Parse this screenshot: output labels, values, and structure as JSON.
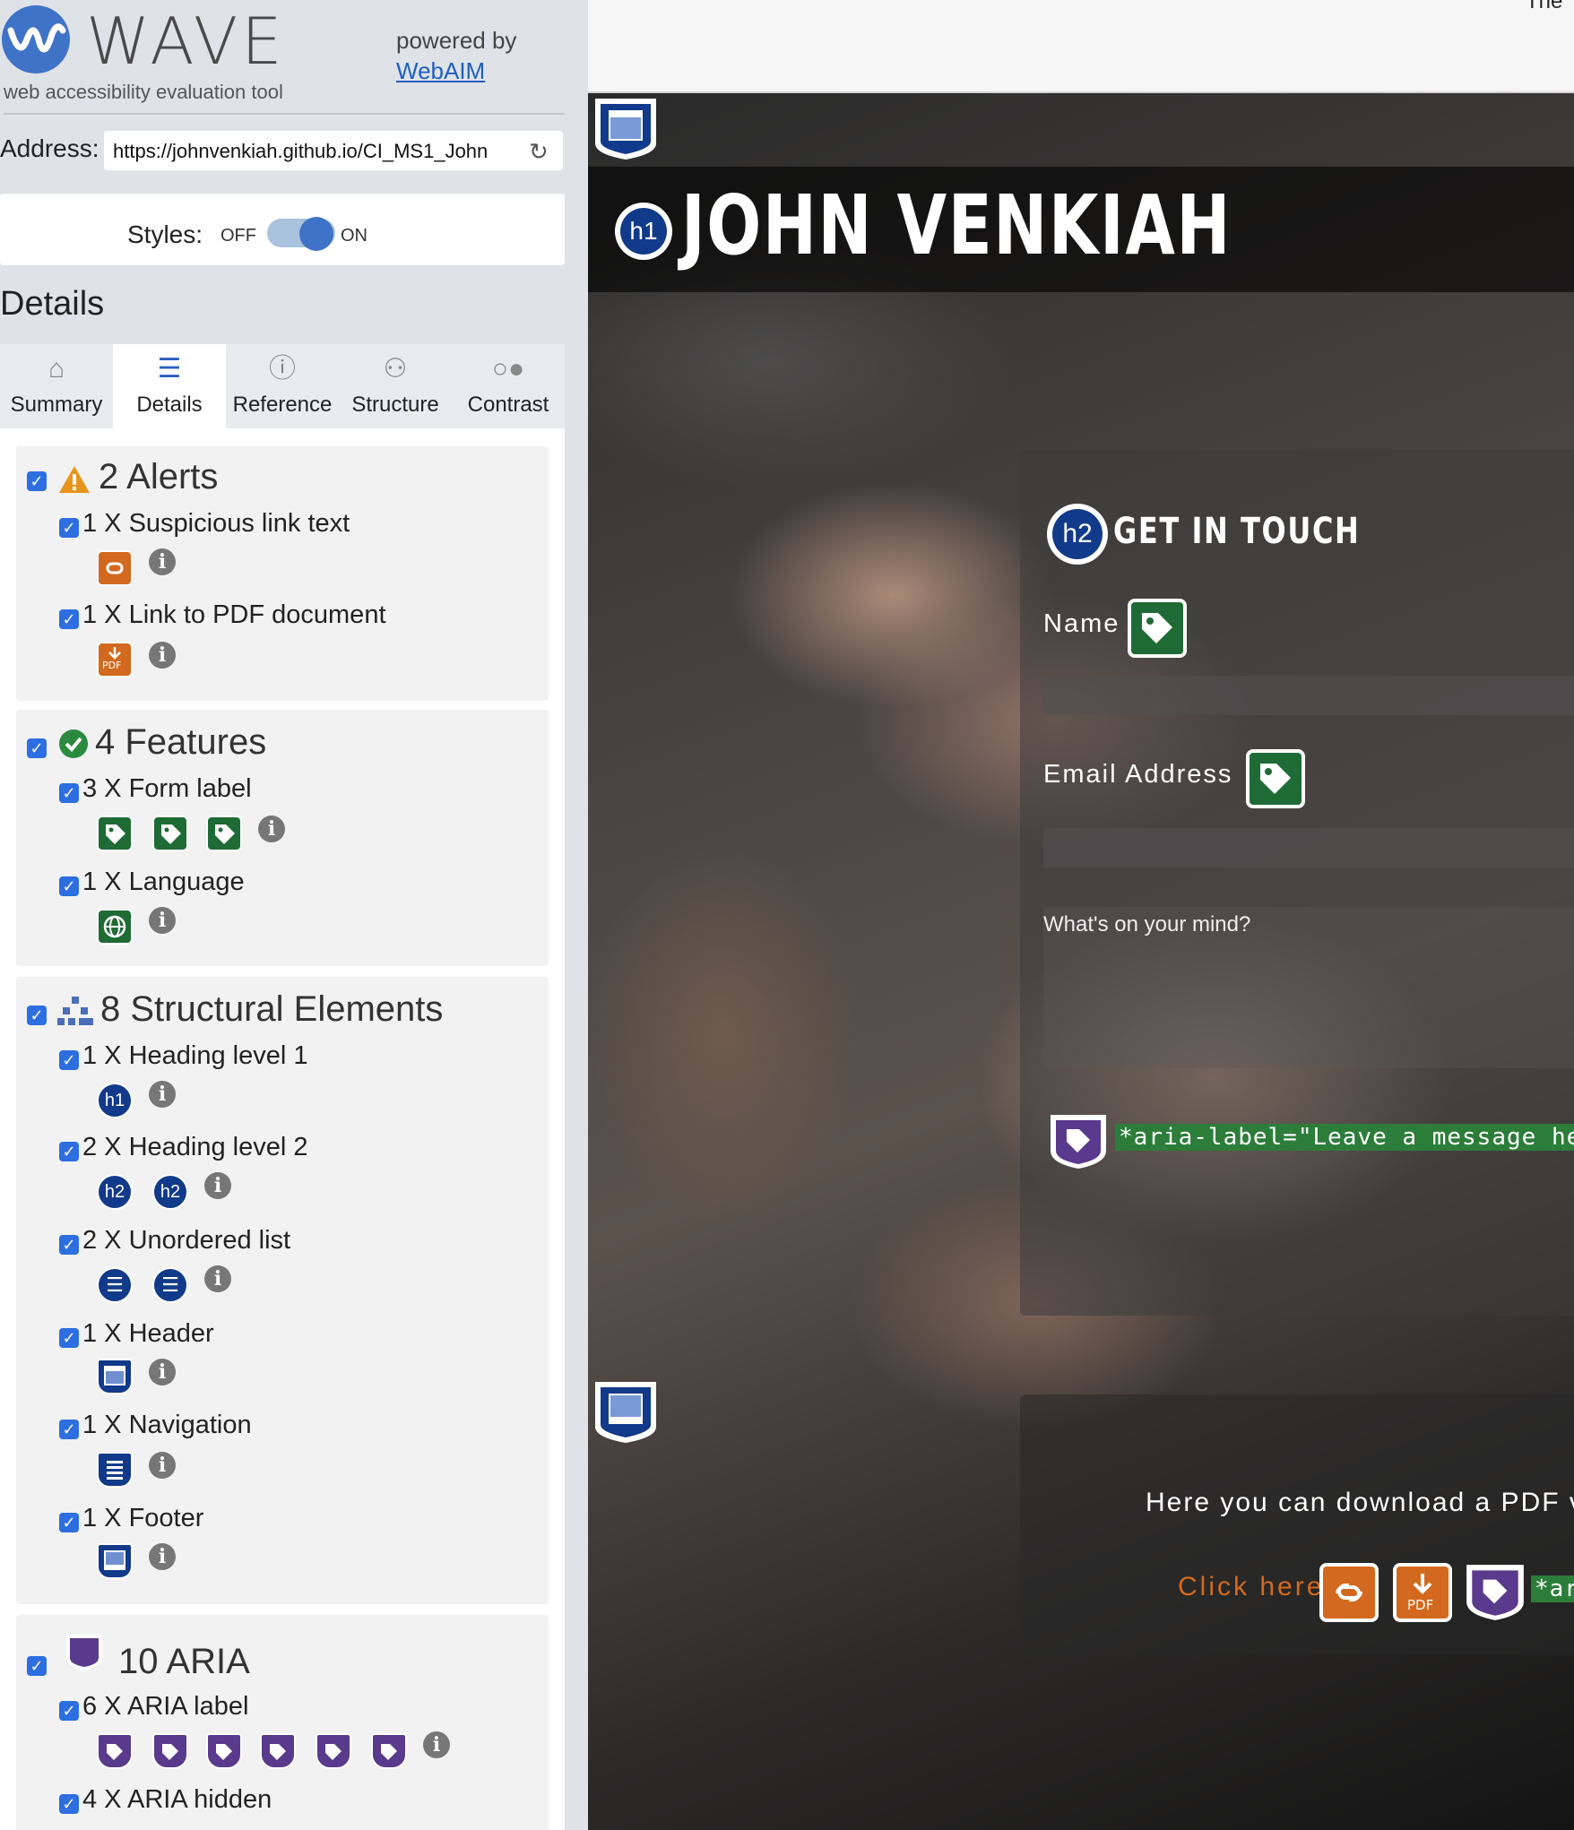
{
  "app": {
    "name": "WAVE",
    "tagline": "web accessibility evaluation tool",
    "powered_by": "powered by",
    "webaim_link": "WebAIM"
  },
  "address": {
    "label": "Address:",
    "value": "https://johnvenkiah.github.io/CI_MS1_John"
  },
  "styles": {
    "label": "Styles:",
    "off": "OFF",
    "on": "ON",
    "enabled": true
  },
  "details_title": "Details",
  "tabs": [
    {
      "label": "Summary",
      "icon": "home-icon"
    },
    {
      "label": "Details",
      "icon": "list-icon",
      "active": true
    },
    {
      "label": "Reference",
      "icon": "info-icon"
    },
    {
      "label": "Structure",
      "icon": "hierarchy-icon"
    },
    {
      "label": "Contrast",
      "icon": "contrast-icon"
    }
  ],
  "groups": {
    "alerts": {
      "title": "2 Alerts",
      "items": [
        {
          "label": "1 X Suspicious link text"
        },
        {
          "label": "1 X Link to PDF document"
        }
      ]
    },
    "features": {
      "title": "4 Features",
      "items": [
        {
          "label": "3 X Form label"
        },
        {
          "label": "1 X Language"
        }
      ]
    },
    "structure": {
      "title": "8 Structural Elements",
      "items": [
        {
          "label": "1 X Heading level 1",
          "icon_text": "h1"
        },
        {
          "label": "2 X Heading level 2",
          "icon_text": "h2"
        },
        {
          "label": "2 X Unordered list"
        },
        {
          "label": "1 X Header"
        },
        {
          "label": "1 X Navigation"
        },
        {
          "label": "1 X Footer"
        }
      ]
    },
    "aria": {
      "title": "10 ARIA",
      "items": [
        {
          "label": "6 X ARIA label"
        },
        {
          "label": "4 X ARIA hidden"
        }
      ]
    }
  },
  "info_glyph": "i",
  "page": {
    "title": "JOHN VENKIAH",
    "h1_badge": "h1",
    "h2_badge": "h2",
    "contact_title": "GET IN TOUCH",
    "name_label": "Name",
    "email_label": "Email Address",
    "message_placeholder": "What's on your mind?",
    "aria_label_text": "*aria-label=\"Leave a message here\"*",
    "download_text": "Here you can download a PDF v",
    "click_here": "Click here",
    "aria_label_short": "*ar",
    "top_right_text": "The"
  },
  "colors": {
    "alert_orange": "#d2691e",
    "feature_green": "#1f6b35",
    "structure_blue": "#123a8a",
    "aria_purple": "#5a3a8c",
    "checkbox_blue": "#2d6ee0"
  }
}
